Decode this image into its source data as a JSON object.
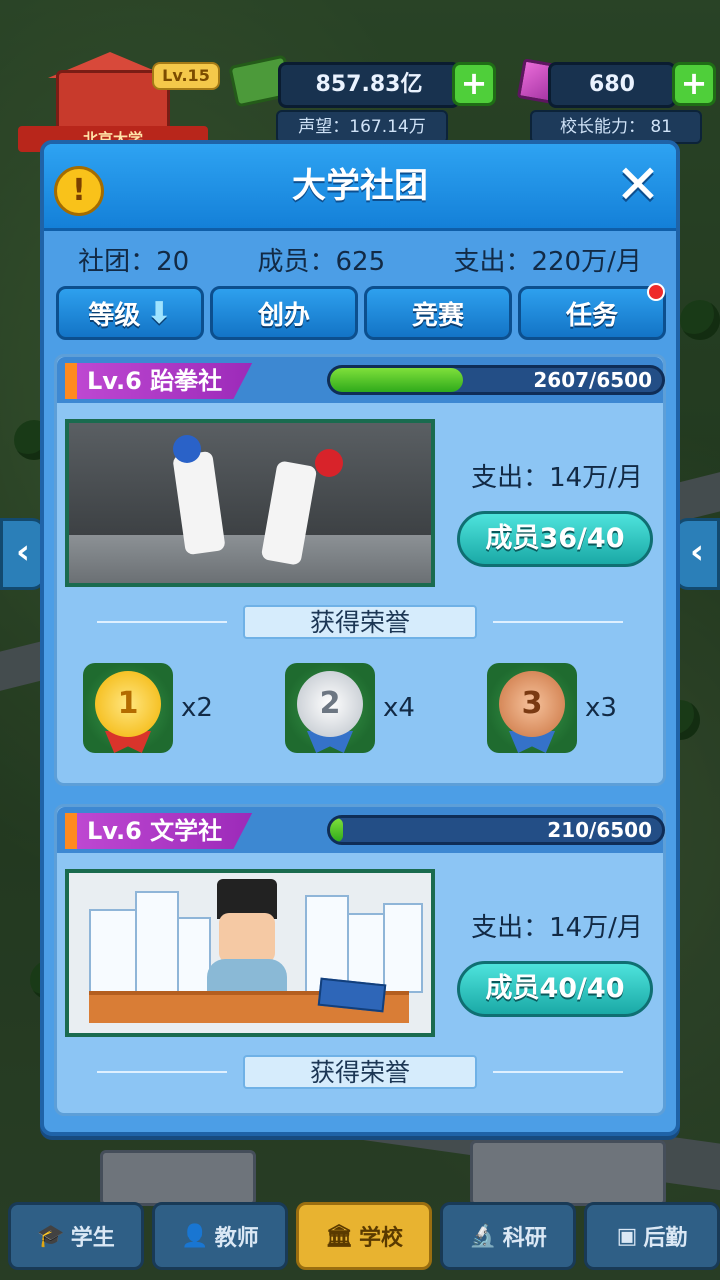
{
  "hud": {
    "school_name": "北京大学",
    "level": "Lv.15",
    "money": "857.83亿",
    "gems": "680",
    "reputation": "声望：167.14万",
    "principal_ability": "校长能力：  81",
    "plus_symbol": "+"
  },
  "modal": {
    "title": "大学社团",
    "info_symbol": "!",
    "close_symbol": "✕",
    "stats": {
      "clubs": "社团：20",
      "members": "成员：625",
      "expense": "支出：220万/月"
    },
    "tabs": [
      {
        "label": "等级",
        "arrow": "⬇"
      },
      {
        "label": "创办"
      },
      {
        "label": "竞赛"
      },
      {
        "label": "任务",
        "has_red_dot": true
      }
    ]
  },
  "clubs": [
    {
      "name": "Lv.6   跆拳社",
      "progress_text": "2607/6500",
      "progress_current": 2607,
      "progress_max": 6500,
      "expense": "支出：14万/月",
      "member_button": "成员36/40",
      "honor_title": "获得荣誉",
      "medals": [
        {
          "rank": "1",
          "count": "x2",
          "color": "gold"
        },
        {
          "rank": "2",
          "count": "x4",
          "color": "silver"
        },
        {
          "rank": "3",
          "count": "x3",
          "color": "bronze"
        }
      ]
    },
    {
      "name": "Lv.6   文学社",
      "progress_text": "210/6500",
      "progress_current": 210,
      "progress_max": 6500,
      "expense": "支出：14万/月",
      "member_button": "成员40/40",
      "honor_title": "获得荣誉"
    }
  ],
  "bottom_nav": [
    {
      "label": "学生",
      "icon": "graduation-cap-icon"
    },
    {
      "label": "教师",
      "icon": "teacher-icon"
    },
    {
      "label": "学校",
      "icon": "school-building-icon",
      "active": true
    },
    {
      "label": "科研",
      "icon": "microscope-icon"
    },
    {
      "label": "后勤",
      "icon": "logistics-card-icon"
    }
  ],
  "colors": {
    "modal_bg": "#4c9ee6",
    "header": "#1480d8",
    "card_bg": "#8cc5f4",
    "progress_fill": "#2faa1b",
    "member_button": "#1aa9a6",
    "name_tag": "#9c2ab9"
  }
}
